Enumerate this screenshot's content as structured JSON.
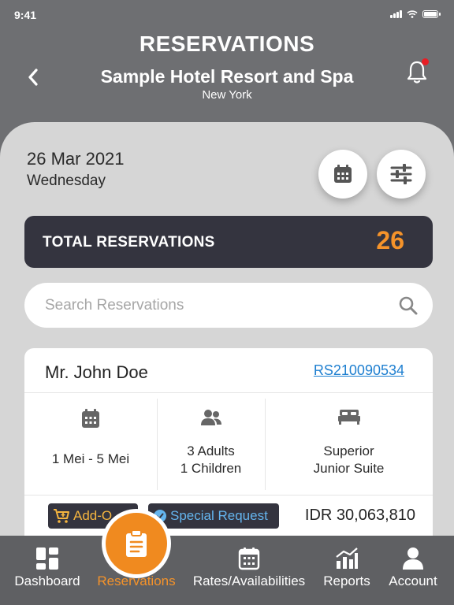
{
  "status_bar": {
    "time": "9:41"
  },
  "header": {
    "title": "RESERVATIONS",
    "hotel_name": "Sample Hotel Resort and Spa",
    "hotel_city": "New York"
  },
  "date": {
    "main": "26 Mar 2021",
    "day": "Wednesday"
  },
  "totals": {
    "label": "TOTAL RESERVATIONS",
    "count": "26"
  },
  "search": {
    "placeholder": "Search Reservations",
    "value": ""
  },
  "reservation": {
    "guest_name": "Mr. John Doe",
    "code": "RS210090534",
    "dates": "1 Mei - 5 Mei",
    "guests_line1": "3 Adults",
    "guests_line2": "1 Children",
    "room_line1": "Superior",
    "room_line2": "Junior Suite",
    "addon_label": "Add-O",
    "special_label": "Special Request",
    "price": "IDR 30,063,810"
  },
  "nav": {
    "items": [
      {
        "label": "Dashboard",
        "icon": "dashboard-icon"
      },
      {
        "label": "Reservations",
        "icon": "clipboard-icon"
      },
      {
        "label": "Rates/Availabilities",
        "icon": "calendar-icon"
      },
      {
        "label": "Reports",
        "icon": "chart-icon"
      },
      {
        "label": "Account",
        "icon": "user-icon"
      }
    ],
    "active": "Reservations"
  },
  "colors": {
    "background": "#6e6f72",
    "panel": "#d6d6d6",
    "dark_bar": "#34343f",
    "accent_orange": "#f5932a",
    "link_blue": "#1e7fd0",
    "notification_red": "#e81e25"
  }
}
